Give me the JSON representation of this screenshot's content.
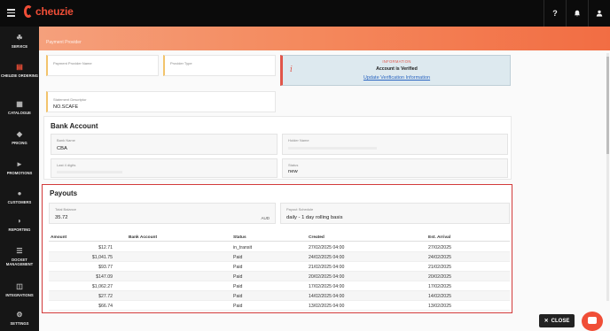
{
  "app": {
    "brand": "cheuzie"
  },
  "topbar": {
    "icons": [
      "help-icon",
      "bell-icon",
      "user-icon"
    ],
    "help_label": "?"
  },
  "sidebar": {
    "items": [
      {
        "label": "SERVICE",
        "icon": "service-icon"
      },
      {
        "label": "CHEUZIE ORDERING",
        "icon": "ordering-icon",
        "active": true
      },
      {
        "label": "CATALOGUE",
        "icon": "catalogue-icon"
      },
      {
        "label": "PRICING",
        "icon": "tag-icon"
      },
      {
        "label": "PROMOTIONS",
        "icon": "megaphone-icon"
      },
      {
        "label": "CUSTOMERS",
        "icon": "users-icon"
      },
      {
        "label": "REPORTING",
        "icon": "chart-icon"
      },
      {
        "label": "DOCKET MANAGEMENT",
        "icon": "docket-icon"
      },
      {
        "label": "INTEGRATIONS",
        "icon": "plug-icon"
      },
      {
        "label": "SETTINGS",
        "icon": "gear-icon"
      }
    ]
  },
  "banner": {
    "title": "Payment Provider"
  },
  "provider": {
    "name_label": "Payment Provider Name",
    "type_label": "Provider Type",
    "statement_label": "Statement Descriptor",
    "statement_value": "NO.SCAFE"
  },
  "info": {
    "heading": "INFORMATION",
    "text": "Account is Verified",
    "link": "Update Verification Information"
  },
  "bank": {
    "title": "Bank Account",
    "bank_name_label": "Bank Name",
    "bank_name_value": "CBA",
    "holder_label": "Holder Name",
    "last4_label": "Last 4 digits",
    "status_label": "Status",
    "status_value": "new"
  },
  "payouts": {
    "title": "Payouts",
    "total_balance_label": "Total Balance",
    "total_balance_value": "35.72",
    "currency": "AUD",
    "schedule_label": "Payout Schedule",
    "schedule_value": "daily - 1 day rolling basis",
    "columns": [
      "Amount",
      "Bank Account",
      "Status",
      "Created",
      "Est. Arrival"
    ],
    "rows": [
      {
        "amount": "$12.71",
        "bank": "",
        "status": "in_transit",
        "created": "27/02/2025 04:00",
        "arrival": "27/02/2025"
      },
      {
        "amount": "$1,041.75",
        "bank": "",
        "status": "Paid",
        "created": "24/02/2025 04:00",
        "arrival": "24/02/2025"
      },
      {
        "amount": "$93.77",
        "bank": "",
        "status": "Paid",
        "created": "21/02/2025 04:00",
        "arrival": "21/02/2025"
      },
      {
        "amount": "$147.09",
        "bank": "",
        "status": "Paid",
        "created": "20/02/2025 04:00",
        "arrival": "20/02/2025"
      },
      {
        "amount": "$1,062.27",
        "bank": "",
        "status": "Paid",
        "created": "17/02/2025 04:00",
        "arrival": "17/02/2025"
      },
      {
        "amount": "$27.72",
        "bank": "",
        "status": "Paid",
        "created": "14/02/2025 04:00",
        "arrival": "14/02/2025"
      },
      {
        "amount": "$66.74",
        "bank": "",
        "status": "Paid",
        "created": "13/02/2025 04:00",
        "arrival": "13/02/2025"
      }
    ]
  },
  "footer": {
    "close_label": "CLOSE"
  }
}
